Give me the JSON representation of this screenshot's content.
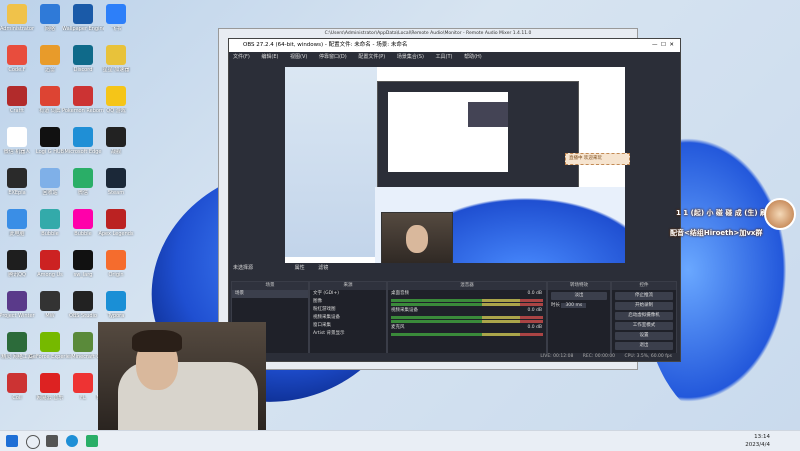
{
  "desktop": {
    "icons": [
      {
        "label": "Administrator",
        "color": "#f0c24a"
      },
      {
        "label": "Code.F",
        "color": "#e84d3d"
      },
      {
        "label": "Crafft",
        "color": "#b22b2b"
      },
      {
        "label": "微信 机器人",
        "color": "#fff"
      },
      {
        "label": "EXEpla",
        "color": "#2a2a2a"
      },
      {
        "label": "此电脑",
        "color": "#3a8ee6"
      },
      {
        "label": "腾讯QQ",
        "color": "#1e1e1e"
      },
      {
        "label": "Project Winter",
        "color": "#5a3a8a"
      },
      {
        "label": "精灵 网络工具",
        "color": "#2c6b3a"
      },
      {
        "label": "Coll",
        "color": "#c33"
      },
      {
        "label": "网络",
        "color": "#2f7ad8"
      },
      {
        "label": "迅雷",
        "color": "#e89b2a"
      },
      {
        "label": "有道 词典",
        "color": "#d43"
      },
      {
        "label": "Logi G HUB",
        "color": "#111"
      },
      {
        "label": "回收站",
        "color": "#7fb0e8"
      },
      {
        "label": "Bubble",
        "color": "#3aa"
      },
      {
        "label": "Among Us",
        "color": "#c22"
      },
      {
        "label": "MW",
        "color": "#333"
      },
      {
        "label": "GeForce Experience",
        "color": "#76b900"
      },
      {
        "label": "网易云 音乐",
        "color": "#d22"
      },
      {
        "label": "Wallpaper Engine",
        "color": "#1a5aa8"
      },
      {
        "label": "Discord",
        "color": "#0f6a8a"
      },
      {
        "label": "Pokemon Reborn",
        "color": "#c33"
      },
      {
        "label": "Microsoft Edge",
        "color": "#1f8fd6"
      },
      {
        "label": "微信",
        "color": "#2aae67"
      },
      {
        "label": "Bubble",
        "color": "#f0a"
      },
      {
        "label": "sw_larg",
        "color": "#111"
      },
      {
        "label": "OBS Studio",
        "color": "#222"
      },
      {
        "label": "Minecraft",
        "color": "#5a8a3a"
      },
      {
        "label": "FL",
        "color": "#e33"
      },
      {
        "label": "飞书",
        "color": "#2d7ff9"
      },
      {
        "label": "星星 加速器",
        "color": "#e8c23a"
      },
      {
        "label": "QQ 游戏",
        "color": "#f5c518"
      },
      {
        "label": "战舰",
        "color": "#222"
      },
      {
        "label": "Steam",
        "color": "#1b2838"
      },
      {
        "label": "Apex Legends",
        "color": "#b22"
      },
      {
        "label": "Origin",
        "color": "#f56c2d"
      },
      {
        "label": "Typora",
        "color": "#1a8fd6"
      },
      {
        "label": "Genshin Impact",
        "color": "#d9b26a"
      },
      {
        "label": "Monster Hunter",
        "color": "#6a8a3a"
      },
      {
        "label": "百度网盘",
        "color": "#06a7ff"
      }
    ]
  },
  "host_window": {
    "title": "C:\\Users\\Administrator\\AppData\\Local\\Remote Audio\\Monitor - Remote Audio Mixer 1.4.11.0"
  },
  "obs": {
    "title": "OBS 27.2.4 (64-bit, windows) - 配置文件: 未命名 - 场景: 未命名",
    "menu": [
      "文件(F)",
      "编辑(E)",
      "视图(V)",
      "停靠窗口(D)",
      "配置文件(P)",
      "场景集合(S)",
      "工具(T)",
      "帮助(H)"
    ],
    "source_bar": "未选择源",
    "source_bar_buttons": [
      "属性",
      "滤镜"
    ],
    "panels": {
      "scenes": {
        "header": "场景",
        "items": [
          "场景"
        ]
      },
      "sources": {
        "header": "来源",
        "items": [
          "文字 (GDI+)",
          "图像",
          "粉红游戏图",
          "视频采集设备",
          "窗口采集",
          "Artist 背景显示"
        ]
      },
      "mixer": {
        "header": "混音器",
        "tracks": [
          {
            "name": "桌面音频",
            "db": "0.0 dB"
          },
          {
            "name": "视频采集设备",
            "db": "0.0 dB"
          },
          {
            "name": "麦克风",
            "db": "0.0 dB"
          }
        ]
      },
      "transitions": {
        "header": "转场特效",
        "type": "淡出",
        "duration_label": "时长",
        "duration": "300 ms"
      },
      "controls": {
        "header": "控件",
        "buttons": [
          "停止推流",
          "开始录制",
          "启动虚拟摄像机",
          "工作室模式",
          "设置",
          "退出"
        ]
      }
    },
    "status": {
      "live": "LIVE: 00:12:08",
      "rec": "REC: 00:00:00",
      "cpu": "CPU: 3.5%, 60.00 fps"
    }
  },
  "overlay": {
    "tag": "直播中 欢迎来玩",
    "line1": "1 1 (起) 小 碰 碰 成 (生) 刷",
    "line2": "配音<结组Hiroeth>加vx群"
  },
  "taskbar": {
    "time": "13:14",
    "date": "2023/4/4"
  }
}
